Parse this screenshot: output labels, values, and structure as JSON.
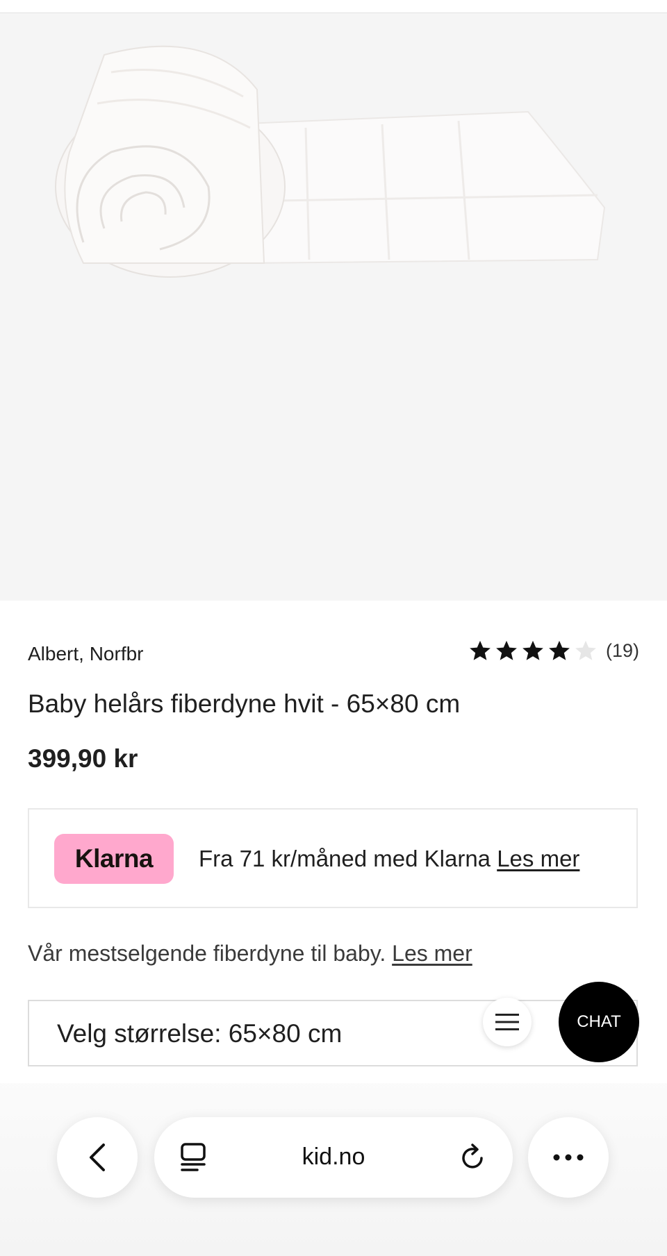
{
  "product": {
    "brand": "Albert, Norfbr",
    "rating": 4,
    "rating_max": 5,
    "rating_count": "(19)",
    "title": "Baby helårs fiberdyne hvit - 65×80 cm",
    "price": "399,90 kr"
  },
  "klarna": {
    "logo": "Klarna",
    "text": "Fra 71 kr/måned med Klarna",
    "link": "Les mer"
  },
  "description": {
    "text": "Vår mestselgende fiberdyne til baby.",
    "link": "Les mer"
  },
  "size_select": {
    "label": "Velg størrelse: 65×80 cm"
  },
  "chat": {
    "label": "CHAT"
  },
  "browser": {
    "url": "kid.no",
    "icons": [
      "back-icon",
      "tabs-icon",
      "reload-icon",
      "more-icon"
    ]
  },
  "colors": {
    "klarna_pink": "#ffa8cd",
    "chat_bg": "#000000",
    "hero_bg": "#f5f5f5"
  }
}
